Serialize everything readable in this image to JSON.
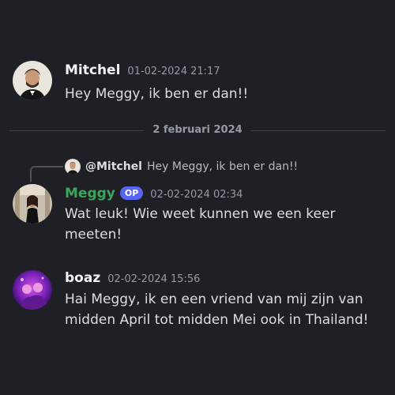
{
  "messages": [
    {
      "author": "Mitchel",
      "timestamp": "01-02-2024 21:17",
      "text": "Hey Meggy, ik ben er dan!!",
      "name_color": "#f2f3f5"
    },
    {
      "author": "Meggy",
      "badge": "OP",
      "timestamp": "02-02-2024 02:34",
      "text": "Wat leuk! Wie weet kunnen we een keer meeten!",
      "name_color": "#3ba55c",
      "reply": {
        "author": "@Mitchel",
        "text": "Hey Meggy, ik ben er dan!!"
      }
    },
    {
      "author": "boaz",
      "timestamp": "02-02-2024 15:56",
      "text": "Hai Meggy, ik en een vriend van mij zijn van midden April tot midden Mei ook in Thailand!",
      "name_color": "#f2f3f5"
    }
  ],
  "date_divider": "2 februari 2024",
  "colors": {
    "background": "#1f2025",
    "op_badge": "#5865f2",
    "meggy_name": "#3ba55c"
  }
}
